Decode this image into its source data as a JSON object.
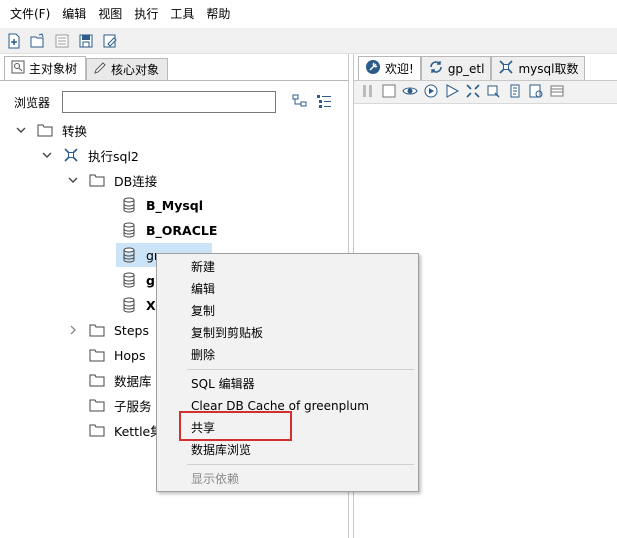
{
  "menubar": {
    "items": [
      "文件(F)",
      "编辑",
      "视图",
      "执行",
      "工具",
      "帮助"
    ]
  },
  "left_panel": {
    "tabs": [
      {
        "label": "主对象树",
        "icon": "search-icon"
      },
      {
        "label": "核心对象",
        "icon": "pencil-icon"
      }
    ],
    "browser_label": "浏览器",
    "browser_value": "",
    "tree": {
      "root": "转换",
      "transform": "执行sql2",
      "db_folder": "DB连接",
      "connections": [
        "B_Mysql",
        "B_ORACLE",
        "gr",
        "gr",
        "X"
      ],
      "folders": [
        "Steps",
        "Hops",
        "数据库",
        "子服务",
        "Kettle集"
      ]
    }
  },
  "right_panel": {
    "tabs": [
      {
        "label": "欢迎!",
        "icon": "spoon-icon"
      },
      {
        "label": "gp_etl",
        "icon": "job-icon"
      },
      {
        "label": "mysql取数",
        "icon": "transform-icon"
      }
    ]
  },
  "context_menu": {
    "items_group1": [
      "新建",
      "编辑",
      "复制",
      "复制到剪贴板",
      "删除"
    ],
    "items_group2": [
      "SQL 编辑器",
      "Clear DB Cache of greenplum",
      "共享",
      "数据库浏览"
    ],
    "items_group3": [
      "显示依赖"
    ],
    "highlighted_item": "共享",
    "highlight_color": "#d32f2f"
  }
}
